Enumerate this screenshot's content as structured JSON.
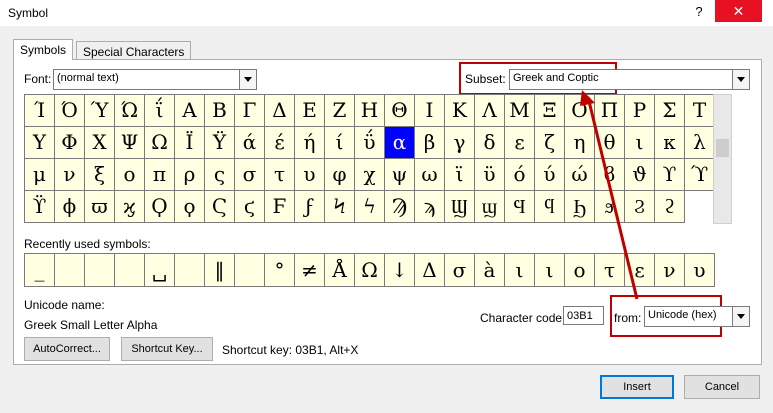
{
  "window": {
    "title": "Symbol",
    "help_label": "?",
    "close_label": "✕"
  },
  "tabs": [
    {
      "label": "Symbols",
      "active": true
    },
    {
      "label": "Special Characters",
      "active": false
    }
  ],
  "font": {
    "label": "Font:",
    "value": "(normal text)"
  },
  "subset": {
    "label": "Subset:",
    "value": "Greek and Coptic"
  },
  "symbols": [
    [
      "Ί",
      "Ό",
      "Ύ",
      "Ώ",
      "ΐ",
      "Α",
      "Β",
      "Γ",
      "Δ",
      "Ε",
      "Ζ",
      "Η",
      "Θ",
      "Ι",
      "Κ",
      "Λ",
      "Μ",
      "Ξ",
      "Ο",
      "Π",
      "Ρ",
      "Σ"
    ],
    [
      "Τ",
      "Υ",
      "Φ",
      "Χ",
      "Ψ",
      "Ω",
      "Ϊ",
      "Ϋ",
      "ά",
      "έ",
      "ή",
      "ί",
      "ΰ",
      "α",
      "β",
      "γ",
      "δ",
      "ε",
      "ζ",
      "η",
      "θ",
      "ι",
      "κ"
    ],
    [
      "λ",
      "μ",
      "ν",
      "ξ",
      "ο",
      "π",
      "ρ",
      "ς",
      "σ",
      "τ",
      "υ",
      "φ",
      "χ",
      "ψ",
      "ω",
      "ϊ",
      "ϋ",
      "ό",
      "ύ",
      "ώ",
      "ϐ",
      "ϑ",
      "ϒ"
    ],
    [
      "ϓ",
      "ϔ",
      "ϕ",
      "ϖ",
      "ϗ",
      "Ϙ",
      "ϙ",
      "Ϛ",
      "ϛ",
      "Ϝ",
      "ϝ",
      "Ϟ",
      "ϟ",
      "Ϡ",
      "ϡ",
      "Ϣ",
      "ϣ",
      "Ϥ",
      "ϥ",
      "Ϧ",
      "ϧ",
      "Ϩ",
      "ϩ"
    ]
  ],
  "selected_symbol": "α",
  "recent": {
    "label": "Recently used symbols:",
    "items": [
      "_",
      "",
      "",
      "",
      "␣",
      "",
      "‖",
      "",
      "°",
      "≠",
      "Å",
      "Ω",
      "↓",
      "Δ",
      "σ",
      "à",
      "ι",
      "ι",
      "ο",
      "τ",
      "ε",
      "ν",
      "υ"
    ]
  },
  "unicode_name": {
    "label": "Unicode name:",
    "value": "Greek Small Letter Alpha"
  },
  "character_code": {
    "label": "Character code:",
    "value": "03B1"
  },
  "from": {
    "label": "from:",
    "value": "Unicode (hex)"
  },
  "buttons": {
    "autocorrect": "AutoCorrect...",
    "shortcut_key": "Shortcut Key...",
    "insert": "Insert",
    "cancel": "Cancel"
  },
  "shortcut_text": "Shortcut key: 03B1, Alt+X",
  "colors": {
    "highlight": "#c00000",
    "selected": "#0000ff",
    "cell_bg": "#ffffe1"
  }
}
